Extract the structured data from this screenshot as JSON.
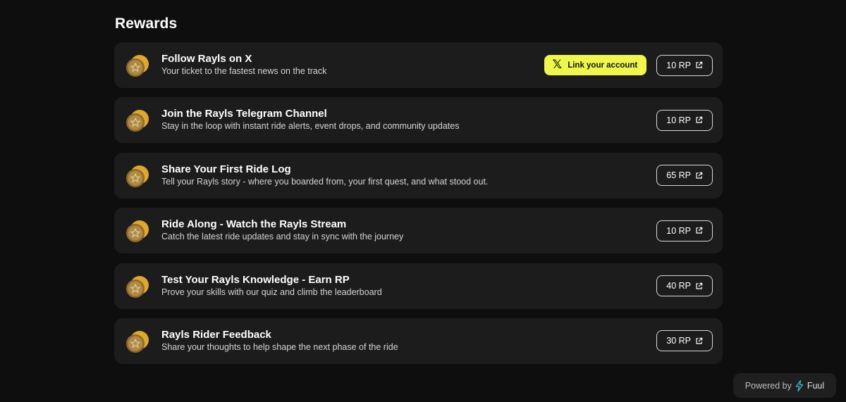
{
  "page": {
    "title": "Rewards"
  },
  "rewards": [
    {
      "title": "Follow Rayls on X",
      "description": "Your ticket to the fastest news on the track",
      "link_button": "Link your account",
      "points": "10 RP"
    },
    {
      "title": "Join the Rayls Telegram Channel",
      "description": "Stay in the loop with instant ride alerts, event drops, and community updates",
      "points": "10 RP"
    },
    {
      "title": "Share Your First Ride Log",
      "description": "Tell your Rayls story - where you boarded from, your first quest, and what stood out.",
      "points": "65 RP"
    },
    {
      "title": "Ride Along - Watch the Rayls Stream",
      "description": "Catch the latest ride updates and stay in sync with the journey",
      "points": "10 RP"
    },
    {
      "title": "Test Your Rayls Knowledge - Earn RP",
      "description": "Prove your skills with our quiz and climb the leaderboard",
      "points": "40 RP"
    },
    {
      "title": "Rayls Rider Feedback",
      "description": "Share your thoughts to help shape the next phase of the ride",
      "points": "30 RP"
    }
  ],
  "footer": {
    "powered_by": "Powered by",
    "brand": "Fuul"
  },
  "icons": {
    "reward": "coin-stack-icon",
    "x": "x-logo-icon",
    "external": "external-link-icon",
    "brand": "bolt-icon"
  },
  "colors": {
    "background": "#0e0e0e",
    "card": "#1c1c1c",
    "accent": "#eef74a",
    "coin": "#c9a24a",
    "brand_bolt": "#3fb8c9"
  }
}
